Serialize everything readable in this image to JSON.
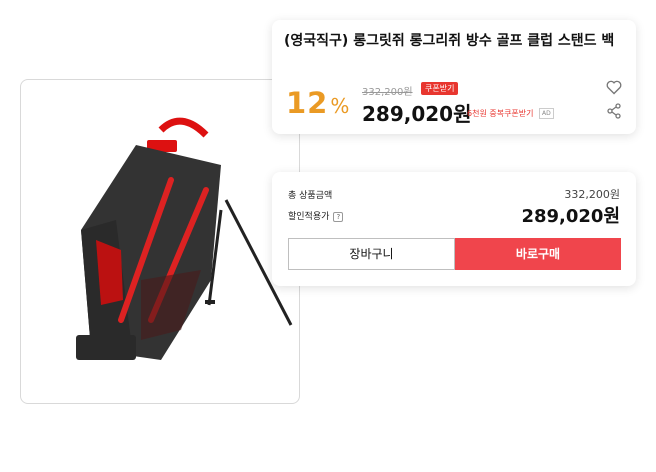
{
  "product": {
    "title": "(영국직구) 롱그릿쥐 롱그리쥐 방수 골프 클럽 스탠드 백",
    "discount_rate": "12",
    "discount_symbol": "%",
    "original_price": "332,200원",
    "coupon_tag": "쿠폰받기",
    "sale_price": "289,020원",
    "duplicate_coupon": "6천원 중복쿠폰받기",
    "ad_badge": "AD",
    "image_icon": "golf-bag-image"
  },
  "summary": {
    "total_label": "총 상품금액",
    "total_value": "332,200원",
    "discount_label": "할인적용가",
    "help_symbol": "?",
    "final_value": "289,020원"
  },
  "buttons": {
    "cart": "장바구니",
    "buy": "바로구매"
  },
  "colors": {
    "discount_orange": "#ea9a24",
    "accent_red": "#f0454c",
    "coupon_red": "#e8362f"
  }
}
